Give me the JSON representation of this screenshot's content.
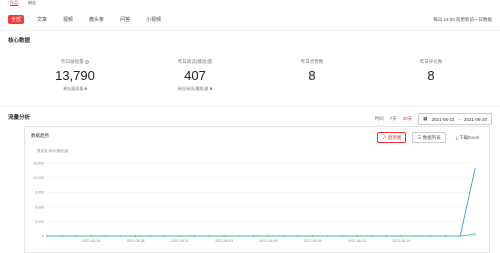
{
  "top_tabs": [
    {
      "label": "作品"
    },
    {
      "label": "粉丝"
    }
  ],
  "filters": [
    {
      "label": "全部",
      "active": true
    },
    {
      "label": "文章"
    },
    {
      "label": "视频"
    },
    {
      "label": "微头条"
    },
    {
      "label": "问答"
    },
    {
      "label": "小视频"
    }
  ],
  "update_note": "每日 14:00 前更新前一日数据",
  "core": {
    "title": "核心数据",
    "metrics": [
      {
        "label": "昨日展现量",
        "value": "13,790",
        "sub_label": "粉丝展现量",
        "sub_value": "0"
      },
      {
        "label": "昨日阅读(播放)量",
        "value": "407",
        "sub_label": "粉丝阅读(播放)量",
        "sub_value": "0"
      },
      {
        "label": "昨日点赞数",
        "value": "8",
        "sub_label": "",
        "sub_value": ""
      },
      {
        "label": "昨日评论数",
        "value": "8",
        "sub_label": "",
        "sub_value": ""
      }
    ]
  },
  "trend": {
    "title": "流量分析",
    "range_label": "时间",
    "ranges": [
      {
        "label": "7天",
        "active": true
      },
      {
        "label": "30天"
      }
    ],
    "date_start": "2021-05-22",
    "date_sep": "-",
    "date_end": "2021-06-20",
    "card_title": "数据趋势",
    "btn_chart": "趋势图",
    "btn_list": "数据列表",
    "btn_download": "下载Excel",
    "legend_note": "展现量·阅读(播放)量"
  },
  "chart_data": {
    "type": "line",
    "x": [
      "2021-05-22",
      "2021-05-23",
      "2021-05-24",
      "2021-05-25",
      "2021-05-26",
      "2021-05-27",
      "2021-05-28",
      "2021-05-29",
      "2021-05-30",
      "2021-05-31",
      "2021-06-01",
      "2021-06-02",
      "2021-06-03",
      "2021-06-04",
      "2021-06-05",
      "2021-06-06",
      "2021-06-07",
      "2021-06-08",
      "2021-06-09",
      "2021-06-10",
      "2021-06-11",
      "2021-06-12",
      "2021-06-13",
      "2021-06-14",
      "2021-06-15",
      "2021-06-16",
      "2021-06-17",
      "2021-06-18",
      "2021-06-19",
      "2021-06-20"
    ],
    "xtick_labels": [
      "2021-05-25",
      "2021-05-28",
      "2021-05-31",
      "2021-06-03",
      "2021-06-06",
      "2021-06-09",
      "2021-06-12",
      "2021-06-15"
    ],
    "yticks": [
      0,
      3000,
      6000,
      9000,
      12000,
      15000
    ],
    "ytick_labels": [
      "0",
      "3,000",
      "6,000",
      "9,000",
      "12,000",
      "15,000"
    ],
    "ylim": [
      0,
      15000
    ],
    "series": [
      {
        "name": "",
        "color": "#2e8fd6",
        "values": [
          0,
          0,
          0,
          0,
          0,
          0,
          0,
          0,
          0,
          0,
          0,
          0,
          0,
          0,
          0,
          0,
          0,
          0,
          0,
          0,
          0,
          0,
          0,
          0,
          0,
          0,
          0,
          0,
          0,
          13790
        ]
      },
      {
        "name": "",
        "color": "#3bbf9a",
        "values": [
          0,
          0,
          0,
          0,
          0,
          0,
          0,
          0,
          0,
          0,
          0,
          0,
          0,
          0,
          0,
          0,
          0,
          0,
          0,
          0,
          0,
          0,
          0,
          0,
          0,
          0,
          0,
          0,
          0,
          407
        ]
      }
    ]
  }
}
